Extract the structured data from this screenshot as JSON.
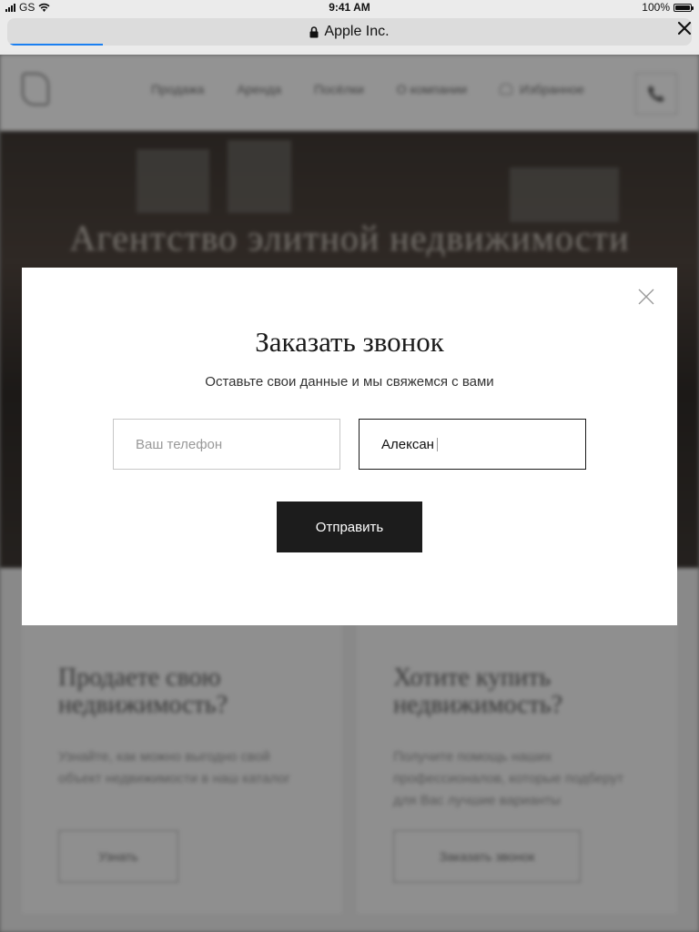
{
  "status_bar": {
    "carrier": "GS",
    "time": "9:41 AM",
    "battery_percent": "100%",
    "battery_level": 1.0
  },
  "browser": {
    "url_title": "Apple Inc.",
    "load_progress": 0.14,
    "accent_color": "#1a7ff1"
  },
  "site": {
    "nav": [
      "Продажа",
      "Аренда",
      "Посёлки",
      "О компании",
      "Избранное"
    ],
    "hero_title": "Агентство элитной недвижимости",
    "cards": [
      {
        "title": "Продаете свою недвижимость?",
        "text": "Узнайте, как можно выгодно свой объект недвижимости в наш каталог",
        "button": "Узнать"
      },
      {
        "title": "Хотите купить недвижимость?",
        "text": "Получите помощь наших профессионалов, которые подберут для Вас лучшие варианты",
        "button": "Заказать звонок"
      }
    ]
  },
  "modal": {
    "title": "Заказать звонок",
    "subtitle": "Оставьте свои данные и мы свяжемся с вами",
    "phone_placeholder": "Ваш телефон",
    "name_value": "Алексан",
    "submit_label": "Отправить"
  }
}
